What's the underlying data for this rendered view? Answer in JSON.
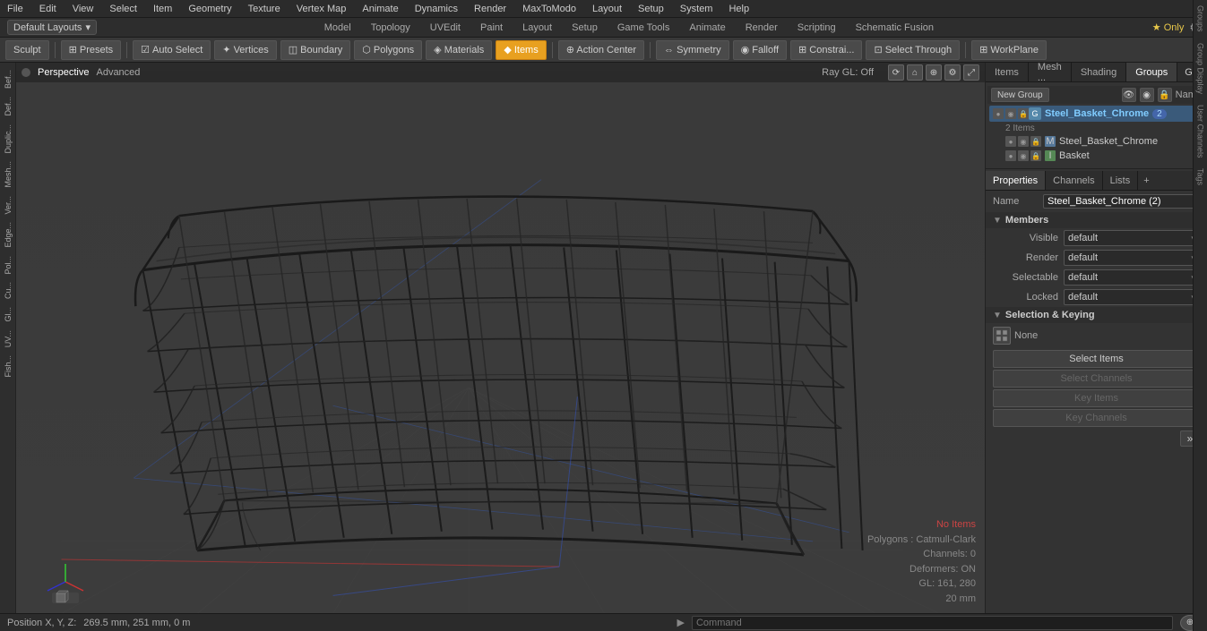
{
  "menu": {
    "items": [
      "File",
      "Edit",
      "View",
      "Select",
      "Item",
      "Geometry",
      "Texture",
      "Vertex Map",
      "Animate",
      "Dynamics",
      "Render",
      "MaxToModo",
      "Layout",
      "Setup",
      "System",
      "Help"
    ]
  },
  "layout_bar": {
    "selector_label": "Default Layouts",
    "mode_tabs": [
      "Model",
      "Topology",
      "UVEdit",
      "Paint",
      "Layout",
      "Setup",
      "Game Tools",
      "Animate",
      "Render",
      "Scripting",
      "Schematic Fusion"
    ],
    "active_tab": "Model",
    "star_only": "★ Only",
    "gear_icon": "⚙"
  },
  "toolbar": {
    "sculpt_label": "Sculpt",
    "presets_label": "⊞ Presets",
    "auto_select_label": "Auto Select",
    "vertices_label": "✦ Vertices",
    "boundary_label": "◫ Boundary",
    "polygons_label": "⬡ Polygons",
    "materials_label": "◈ Materials",
    "items_label": "◆ Items",
    "action_center_label": "⊕ Action Center",
    "symmetry_label": "⇔ Symmetry",
    "falloff_label": "◉ Falloff",
    "constrain_label": "⊞ Constrai...",
    "select_through_label": "⊡ Select Through",
    "workplane_label": "⊞ WorkPlane"
  },
  "viewport": {
    "dot_color": "#555",
    "perspective_label": "Perspective",
    "advanced_label": "Advanced",
    "raygl_label": "Ray GL: Off",
    "no_items_label": "No Items",
    "polygons_info": "Polygons : Catmull-Clark",
    "channels_info": "Channels: 0",
    "deformers_info": "Deformers: ON",
    "gl_coords": "GL: 161, 280",
    "size_info": "20 mm"
  },
  "right_panel": {
    "tabs": [
      "Items",
      "Mesh ...",
      "Shading",
      "Groups"
    ],
    "active_tab": "Groups",
    "new_group_label": "New Group",
    "name_col_label": "Name",
    "group_name": "Steel_Basket_Chrome",
    "group_count": "2",
    "items_count_label": "2 Items",
    "children": [
      {
        "name": "Steel_Basket_Chrome",
        "type": "mesh"
      },
      {
        "name": "Basket",
        "type": "item"
      }
    ]
  },
  "properties": {
    "tabs": [
      "Properties",
      "Channels",
      "Lists"
    ],
    "active_tab": "Properties",
    "name_label": "Name",
    "name_value": "Steel_Basket_Chrome (2)",
    "sections": {
      "members": {
        "label": "Members",
        "visible_label": "Visible",
        "visible_value": "default",
        "render_label": "Render",
        "render_value": "default",
        "selectable_label": "Selectable",
        "selectable_value": "default",
        "locked_label": "Locked",
        "locked_value": "default"
      },
      "selection_keying": {
        "label": "Selection & Keying",
        "none_label": "None",
        "select_items_label": "Select Items",
        "select_channels_label": "Select Channels",
        "key_items_label": "Key Items",
        "key_channels_label": "Key Channels"
      }
    }
  },
  "status_bar": {
    "position_label": "Position X, Y, Z:",
    "position_value": "269.5 mm, 251 mm, 0 m",
    "command_placeholder": "Command"
  },
  "right_vtabs": [
    "Groups",
    "Group Display",
    "User Channels",
    "Tags"
  ],
  "left_sidebar_tabs": [
    "Bef...",
    "Def...",
    "Duplic...",
    "Mesh...",
    "Ver...",
    "Edge...",
    "Pol...",
    "Cu...",
    "Gl...",
    "UV...",
    "Fish..."
  ]
}
